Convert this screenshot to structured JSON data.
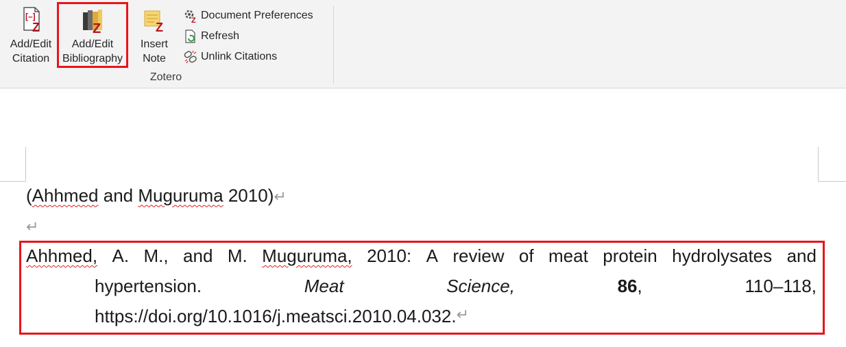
{
  "ribbon": {
    "add_edit_citation": {
      "line1": "Add/Edit",
      "line2": "Citation",
      "icon": "add-citation-icon"
    },
    "add_edit_bibliography": {
      "line1": "Add/Edit",
      "line2": "Bibliography",
      "icon": "add-bibliography-icon"
    },
    "insert_note": {
      "line1": "Insert",
      "line2": "Note",
      "icon": "insert-note-icon"
    },
    "small_buttons": [
      {
        "label": "Document Preferences",
        "icon": "gear-icon"
      },
      {
        "label": "Refresh",
        "icon": "refresh-icon"
      },
      {
        "label": "Unlink Citations",
        "icon": "unlink-icon"
      }
    ],
    "group_label": "Zotero",
    "highlight_color": "#e8141a"
  },
  "document": {
    "citation": {
      "open": "(",
      "author1": "Ahhmed",
      "and": " and ",
      "author2": "Muguruma",
      "year_close": " 2010)"
    },
    "paragraph_mark": "↵",
    "bibliography": {
      "line1": [
        "Ahhmed,",
        "A.",
        "M.,",
        "and",
        "M.",
        "Muguruma,",
        "2010:",
        "A",
        "review",
        "of",
        "meat",
        "protein",
        "hydrolysates",
        "and"
      ],
      "line2": {
        "w1": "hypertension.",
        "w2": "Meat",
        "w3": "Science,",
        "w4": "86",
        "w4_suffix": ",",
        "w5": "110–118,"
      },
      "line3": "https://doi.org/10.1016/j.meatsci.2010.04.032."
    }
  }
}
